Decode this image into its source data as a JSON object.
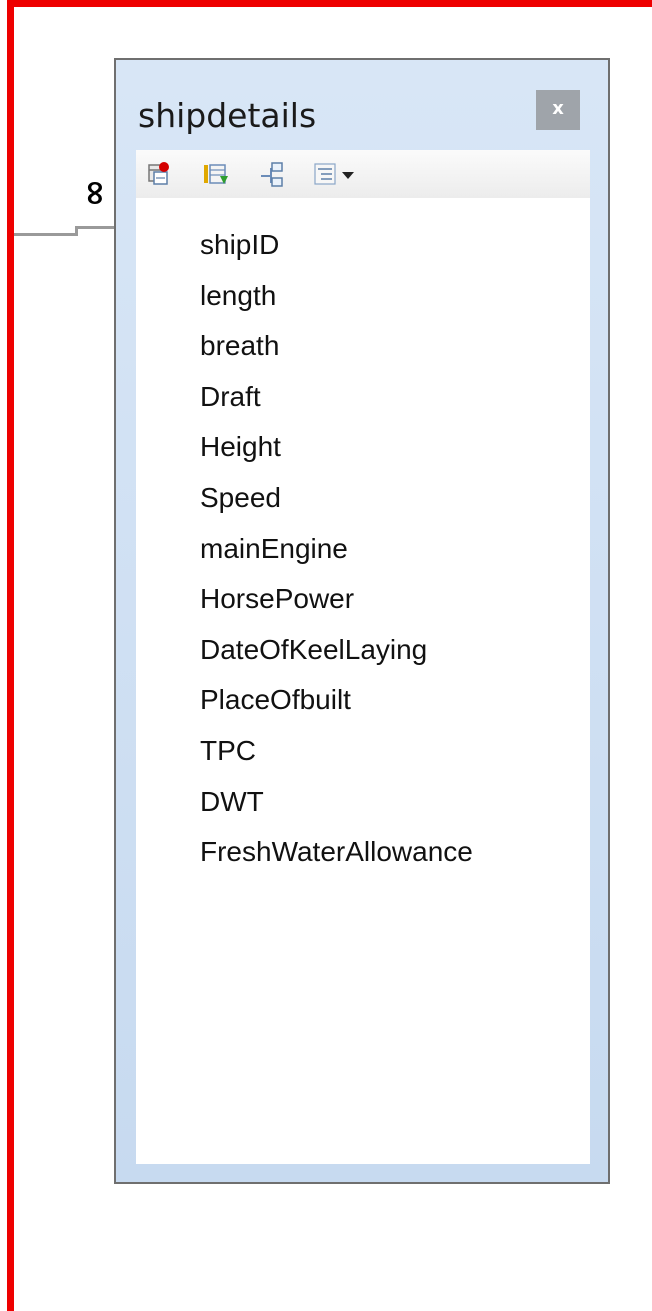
{
  "table": {
    "title": "shipdetails",
    "close_label": "x",
    "relationship_symbol": "∞",
    "toolbar": [
      "add-table-icon",
      "columns-icon",
      "relationships-icon",
      "view-options-icon"
    ],
    "fields": [
      "shipID",
      "length",
      "breath",
      "Draft",
      "Height",
      "Speed",
      "mainEngine",
      "HorsePower",
      "DateOfKeelLaying",
      "PlaceOfbuilt",
      "TPC",
      "DWT",
      "FreshWaterAllowance"
    ]
  },
  "colors": {
    "selection_border": "#ee0000",
    "table_frame": "#d8e6f6",
    "close_button": "#9fa4aa",
    "relationship_line": "#9a9a9a"
  }
}
